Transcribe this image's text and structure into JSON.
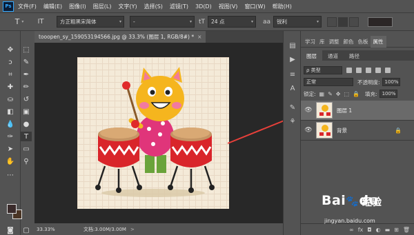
{
  "app": {
    "logo": "Ps"
  },
  "menu": [
    "文件(F)",
    "编辑(E)",
    "图像(I)",
    "图层(L)",
    "文字(Y)",
    "选择(S)",
    "滤镜(T)",
    "3D(D)",
    "视图(V)",
    "窗口(W)",
    "帮助(H)"
  ],
  "options": {
    "tool_icon": "T",
    "orientation_icon": "IT",
    "font_family": "方正粗黑宋简体",
    "font_style": "-",
    "font_size": "24 点",
    "antialias": "锐利",
    "text_color": "#2b2626"
  },
  "document": {
    "tab_title": "tooopen_sy_159053194566.jpg @ 33.3% (图层 1, RGB/8#) *",
    "close": "×",
    "zoom": "33.33%",
    "doc_size": "文档:3.00M/3.00M",
    "arrow": ">"
  },
  "tools": {
    "foreground": "#3a2b2b",
    "background": "#4a3525"
  },
  "panels": {
    "top_tabs": [
      "学习",
      "库",
      "调整",
      "颜色",
      "色板",
      "属性"
    ],
    "active_top_tab": "属性",
    "layer_tabs": [
      "图层",
      "通道",
      "路径"
    ],
    "filter_kind": "ρ 类型",
    "blend_mode": "正常",
    "opacity_label": "不透明度:",
    "opacity_value": "100%",
    "lock_label": "锁定:",
    "fill_label": "填充:",
    "fill_value": "100%"
  },
  "layers": [
    {
      "name": "图层 1",
      "selected": true,
      "locked": false
    },
    {
      "name": "背景",
      "selected": false,
      "locked": true
    }
  ],
  "watermark": {
    "logo": "Bai",
    "logo2": "du",
    "sub": "经验",
    "url": "jingyan.baidu.com"
  },
  "colors": {
    "arrow": "#e8403a"
  }
}
